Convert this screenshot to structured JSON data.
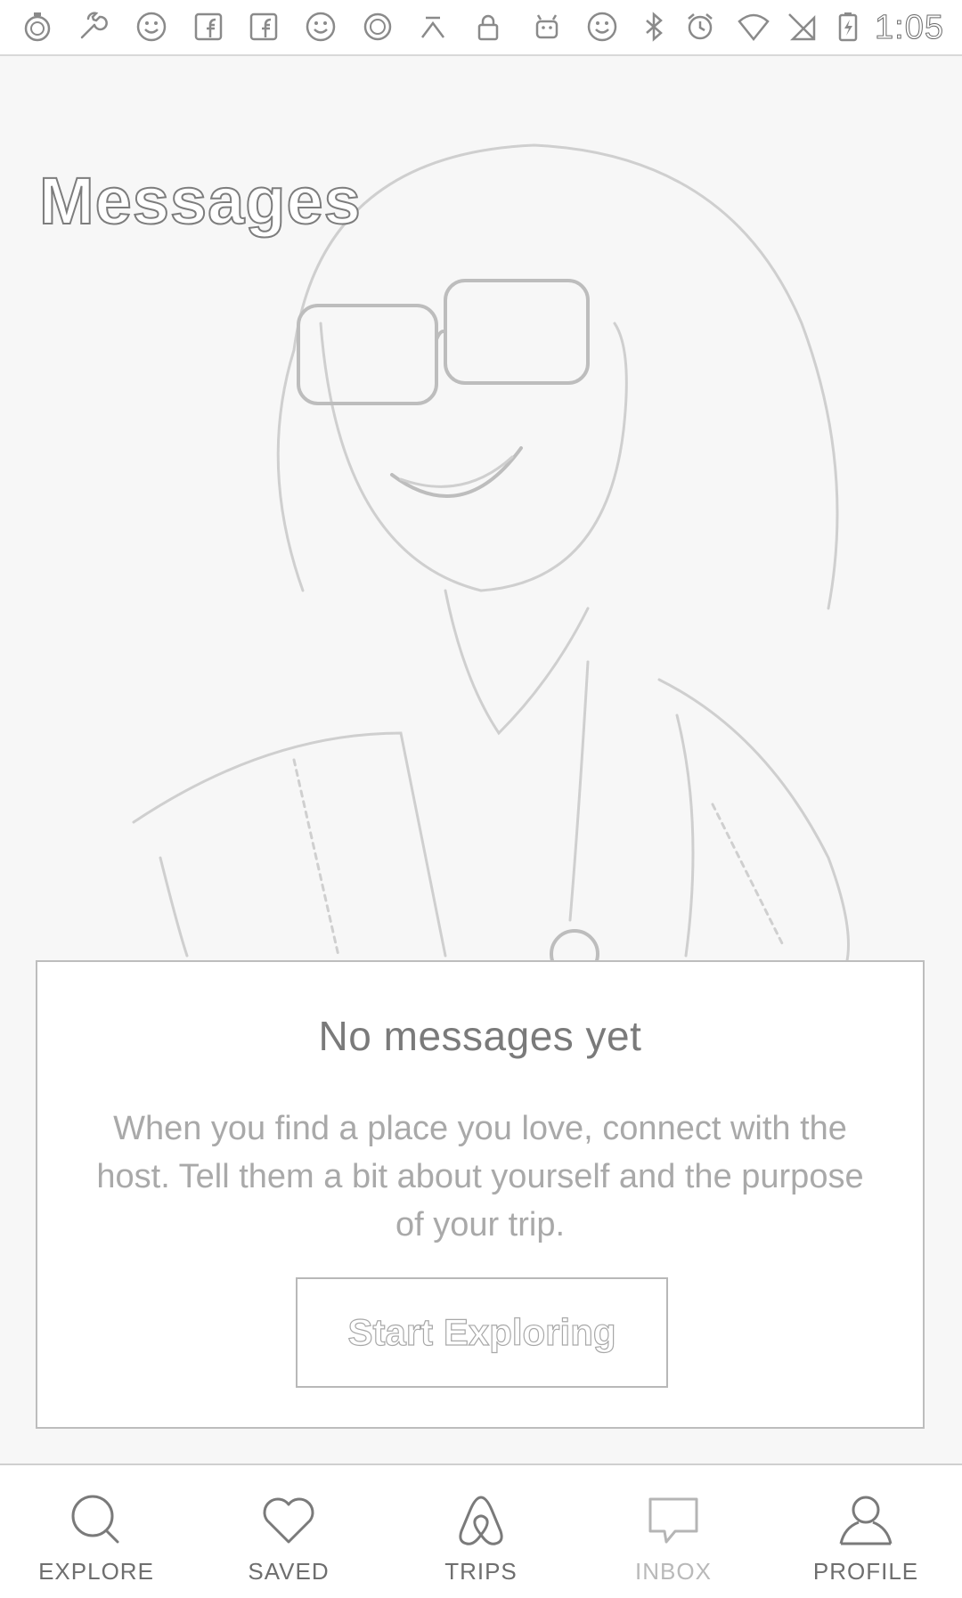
{
  "status_bar": {
    "time": "1:05",
    "icons": [
      "stopwatch-icon",
      "wrench-icon",
      "smiley-icon",
      "facebook-icon",
      "facebook-icon",
      "smiley-icon",
      "circle-icon",
      "fav-icon",
      "lock-icon",
      "android-icon",
      "smiley-icon",
      "bluetooth-icon",
      "alarm-icon",
      "wifi-icon",
      "no-sim-icon",
      "battery-charging-icon"
    ]
  },
  "header": {
    "title": "Messages"
  },
  "empty_state": {
    "title": "No messages yet",
    "body": "When you find a place you love, connect with the host. Tell them a bit about yourself and the purpose of your trip.",
    "button_label": "Start Exploring"
  },
  "bottom_nav": {
    "active": "inbox",
    "items": [
      {
        "label": "EXPLORE",
        "icon": "search-icon"
      },
      {
        "label": "SAVED",
        "icon": "heart-icon"
      },
      {
        "label": "TRIPS",
        "icon": "airbnb-logo-icon"
      },
      {
        "label": "INBOX",
        "icon": "chat-bubble-icon"
      },
      {
        "label": "PROFILE",
        "icon": "person-icon"
      }
    ]
  },
  "colors": {
    "background": "#ffffff",
    "text": "#6d6d6d",
    "muted_text": "#a9a9a9",
    "border": "#bdbdbd"
  }
}
